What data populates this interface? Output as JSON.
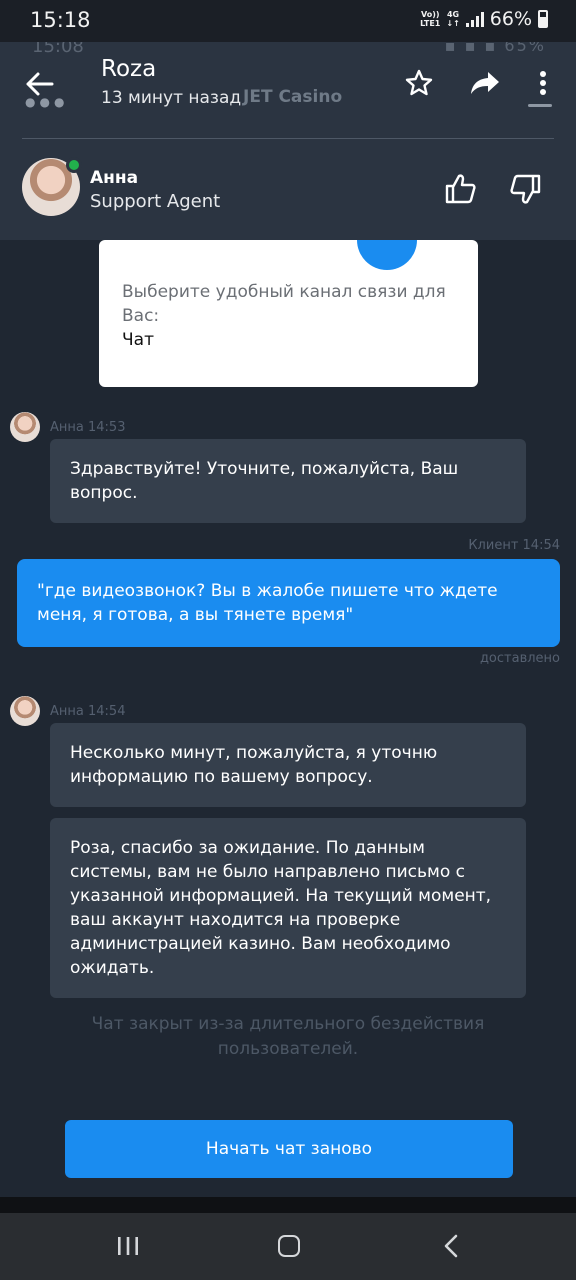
{
  "status_bar": {
    "time": "15:18",
    "volte_line1": "Vo))",
    "volte_line2": "LTE1",
    "network": "4G",
    "battery": "66%"
  },
  "ghost_row": {
    "time": "15:08",
    "right": "▪ ▪ ▪ 65%"
  },
  "app_bar": {
    "title": "Roza",
    "subtitle": "13 минут назад",
    "brand": "JET Casino",
    "icons": [
      "back-arrow-icon",
      "star-icon",
      "share-icon",
      "more-vert-icon"
    ]
  },
  "agent": {
    "name": "Анна",
    "role": "Support Agent",
    "status_color": "#22b14c"
  },
  "channel_card": {
    "prompt": "Выберите удобный канал связи для Вас:",
    "choice": "Чат"
  },
  "messages": [
    {
      "sender": "Анна",
      "time": "14:53",
      "text": "Здравствуйте! Уточните, пожалуйста, Ваш вопрос."
    },
    {
      "sender": "Клиент",
      "time": "14:54",
      "text": "\"где видеозвонок? Вы в жалобе пишете что ждете меня, я готова, а вы тянете время\"",
      "status": "доставлено"
    },
    {
      "sender": "Анна",
      "time": "14:54",
      "text": "Несколько минут, пожалуйста, я уточню информацию по вашему вопросу."
    },
    {
      "text": "Роза, спасибо за ожидание. По данным системы, вам не было направлено письмо с указанной информацией. На текущий момент, ваш аккаунт находится на проверке администрацией казино. Вам необходимо ожидать."
    }
  ],
  "closed_note": "Чат закрыт из-за длительного бездействия пользователей.",
  "restart_button": "Начать чат заново",
  "colors": {
    "accent": "#1a8cf0",
    "background": "#1f2732",
    "header": "#2b3441",
    "agent_bubble": "#353f4c"
  }
}
